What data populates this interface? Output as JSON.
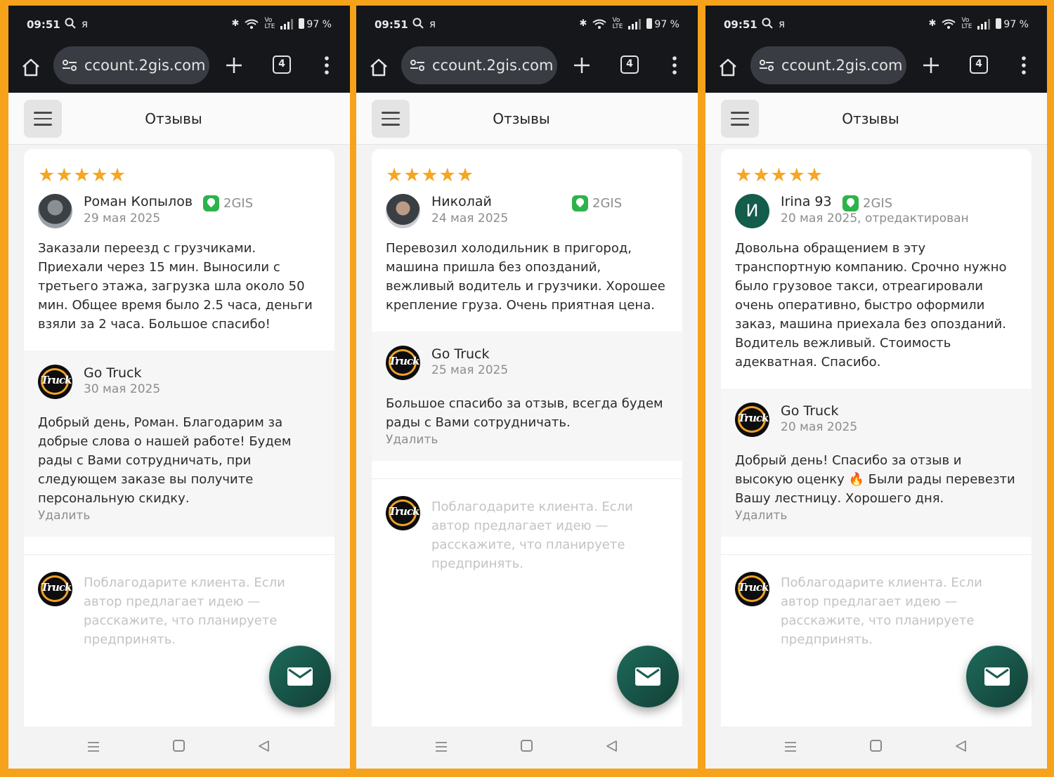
{
  "screens": [
    {
      "status": {
        "time": "09:51",
        "ya": "я",
        "battery": "97 %"
      },
      "browser": {
        "url": "ccount.2gis.com",
        "tabs_count": "4"
      },
      "header": {
        "title": "Отзывы"
      },
      "review": {
        "stars": "★★★★★",
        "rating": 5,
        "author": "Роман Копылов",
        "source": "2GIS",
        "date": "29 мая 2025",
        "text": "Заказали переезд с грузчиками. Приехали через 15 мин. Выносили с третьего этажа, загрузка шла около 50 мин. Общее время было 2.5 часа, деньги взяли за 2 часа. Большое спасибо!"
      },
      "answer": {
        "company": "Go Truck",
        "logo_text": "Truck",
        "date": "30 мая 2025",
        "text": "Добрый день, Роман. Благодарим за добрые слова о нашей работе! Будем рады с Вами сотрудничать, при следующем заказе вы получите персональную скидку.",
        "delete_label": "Удалить"
      },
      "reply": {
        "placeholder": "Поблагодарите клиента. Если автор предлагает идею — расскажите, что планируете предпринять."
      }
    },
    {
      "status": {
        "time": "09:51",
        "ya": "я",
        "battery": "97 %"
      },
      "browser": {
        "url": "ccount.2gis.com",
        "tabs_count": "4"
      },
      "header": {
        "title": "Отзывы"
      },
      "review": {
        "stars": "★★★★★",
        "rating": 5,
        "author": "Николай",
        "source": "2GIS",
        "date": "24 мая 2025",
        "text": "Перевозил холодильник в пригород, машина пришла без опозданий, вежливый водитель и грузчики. Хорошее крепление груза. Очень приятная цена."
      },
      "answer": {
        "company": "Go Truck",
        "logo_text": "Truck",
        "date": "25 мая 2025",
        "text": "Большое спасибо за отзыв, всегда будем рады с Вами сотрудничать.",
        "delete_label": "Удалить"
      },
      "reply": {
        "placeholder": "Поблагодарите клиента. Если автор предлагает идею — расскажите, что планируете предпринять."
      }
    },
    {
      "status": {
        "time": "09:51",
        "ya": "я",
        "battery": "97 %"
      },
      "browser": {
        "url": "ccount.2gis.com",
        "tabs_count": "4"
      },
      "header": {
        "title": "Отзывы"
      },
      "review": {
        "stars": "★★★★★",
        "rating": 5,
        "avatar_letter": "И",
        "author": "Irina 93",
        "source": "2GIS",
        "date": "20 мая 2025, отредактирован",
        "text": "Довольна обращением в эту транспортную компанию. Срочно нужно было грузовое такси, отреагировали очень оперативно, быстро оформили заказ, машина приехала без опозданий. Водитель вежливый. Стоимость адекватная. Спасибо."
      },
      "answer": {
        "company": "Go Truck",
        "logo_text": "Truck",
        "date": "20 мая 2025",
        "text": "Добрый день! Спасибо за отзыв и высокую оценку 🔥 Были рады перевезти Вашу лестницу. Хорошего дня.",
        "delete_label": "Удалить"
      },
      "reply": {
        "placeholder": "Поблагодарите клиента. Если автор предлагает идею — расскажите, что планируете предпринять."
      }
    }
  ],
  "colors": {
    "frame": "#f7a21b",
    "accent_green": "#2cb34a",
    "fab": "#1e6b5b",
    "stars": "#f5a623"
  }
}
